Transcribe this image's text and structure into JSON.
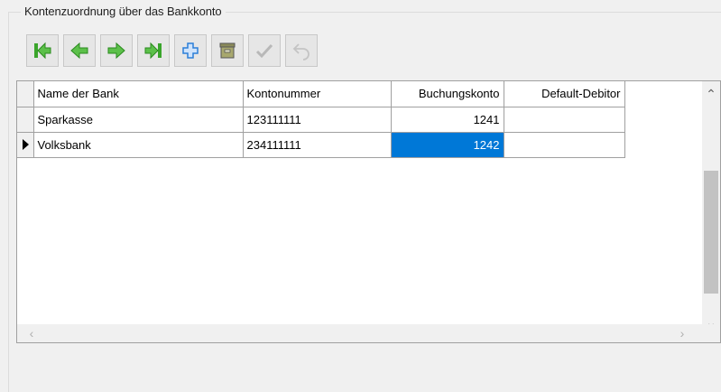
{
  "group": {
    "title": "Kontenzuordnung über das Bankkonto"
  },
  "toolbar": {
    "buttons": [
      {
        "icon": "first-record-icon",
        "enabled": true
      },
      {
        "icon": "previous-record-icon",
        "enabled": true
      },
      {
        "icon": "next-record-icon",
        "enabled": true
      },
      {
        "icon": "last-record-icon",
        "enabled": true
      },
      {
        "icon": "add-record-icon",
        "enabled": true
      },
      {
        "icon": "delete-record-icon",
        "enabled": true
      },
      {
        "icon": "confirm-icon",
        "enabled": false
      },
      {
        "icon": "undo-icon",
        "enabled": false
      }
    ]
  },
  "grid": {
    "columns": [
      "Name der Bank",
      "Kontonummer",
      "Buchungskonto",
      "Default-Debitor"
    ],
    "rows": [
      {
        "name": "Sparkasse",
        "kontonummer": "123111111",
        "buchungskonto": "1241",
        "default_debitor": ""
      },
      {
        "name": "Volksbank",
        "kontonummer": "234111111",
        "buchungskonto": "1242",
        "default_debitor": ""
      }
    ],
    "current_row": 1,
    "selected_cell": "Buchungskonto",
    "selection_color": "#0078d7"
  },
  "colors": {
    "toolbar_green": "#3aa52b",
    "toolbar_blue": "#2b7fd8"
  }
}
